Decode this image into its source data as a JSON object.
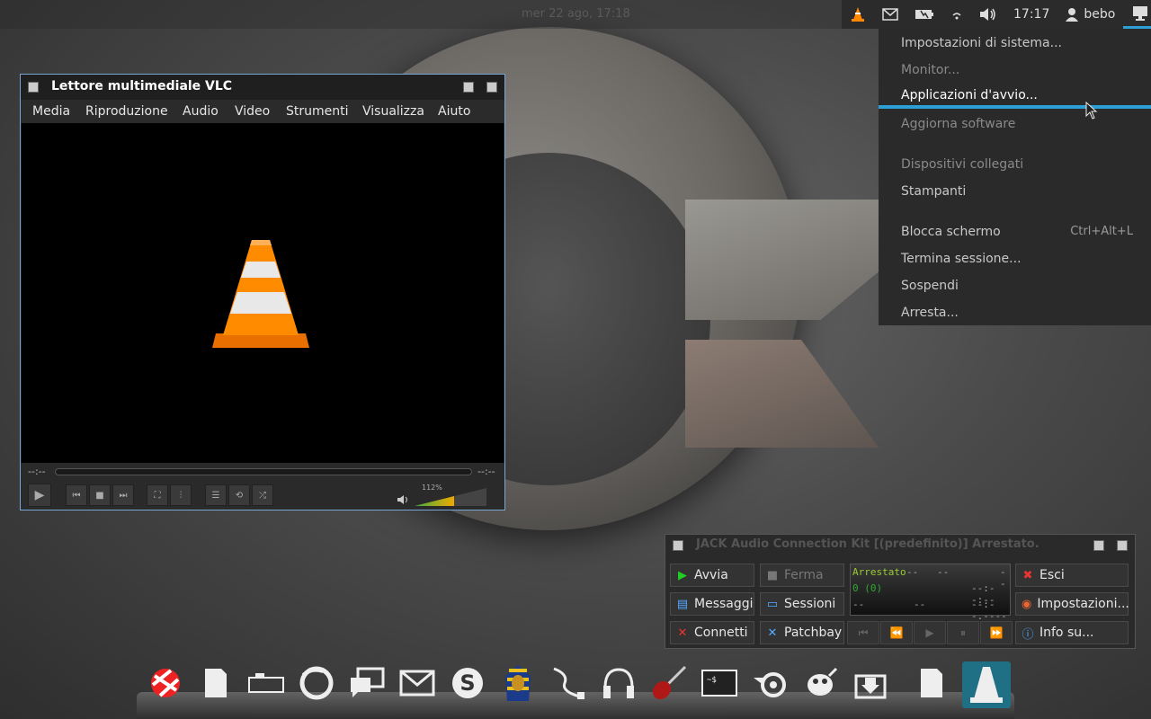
{
  "top_panel": {
    "date_time": "mer 22 ago, 17:18",
    "tray": {
      "clock": "17:17",
      "user": "bebo"
    }
  },
  "system_menu": {
    "items": [
      {
        "label": "Impostazioni di sistema...",
        "state": "normal"
      },
      {
        "label": "Monitor...",
        "state": "dim"
      },
      {
        "label": "Applicazioni d'avvio...",
        "state": "highlighted"
      },
      {
        "label": "Aggiorna software",
        "state": "dim"
      },
      {
        "label": "Dispositivi collegati",
        "state": "dim"
      },
      {
        "label": "Stampanti",
        "state": "normal"
      },
      {
        "label": "Blocca schermo",
        "state": "normal",
        "accel": "Ctrl+Alt+L"
      },
      {
        "label": "Termina sessione...",
        "state": "normal"
      },
      {
        "label": "Sospendi",
        "state": "normal"
      },
      {
        "label": "Arresta...",
        "state": "normal"
      }
    ]
  },
  "vlc": {
    "title": "Lettore multimediale VLC",
    "menu": [
      "Media",
      "Riproduzione",
      "Audio",
      "Video",
      "Strumenti",
      "Visualizza",
      "Aiuto"
    ],
    "elapsed": "--:--",
    "remaining": "--:--",
    "volume_label": "112%",
    "volume_fraction": 0.55
  },
  "jack": {
    "title": "JACK Audio Connection Kit [(predefinito)] Arrestato.",
    "buttons": {
      "start": "Avvia",
      "stop": "Ferma",
      "quit": "Esci",
      "messages": "Messaggi",
      "sessions": "Sessioni",
      "settings": "Impostazioni...",
      "connect": "Connetti",
      "patchbay": "Patchbay",
      "about": "Info su..."
    },
    "display": {
      "status": "Arrestato",
      "dash1": "--",
      "dash2": "--",
      "dash3": "--",
      "xruns": "0 (0)",
      "time": "--:--:--",
      "rate": "--",
      "dash4": "--",
      "time2": "--:--.----"
    }
  },
  "colors": {
    "accent": "#2b9fd6",
    "vlc_border": "#7aa6d6"
  }
}
